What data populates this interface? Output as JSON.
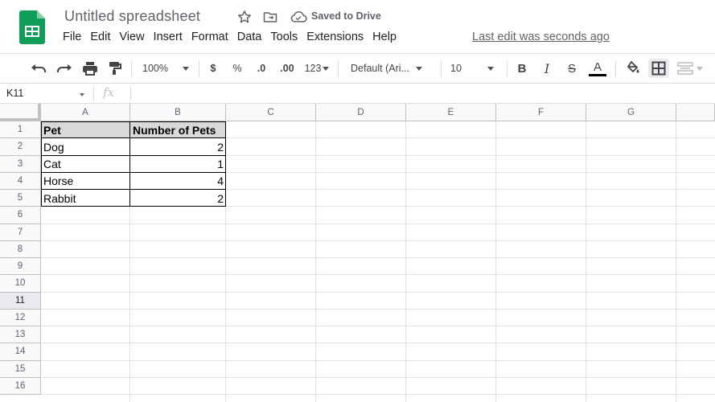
{
  "app": {
    "doc_title": "Untitled spreadsheet",
    "saved_status": "Saved to Drive",
    "last_edit": "Last edit was seconds ago",
    "brand_color": "#0f9d58"
  },
  "menu": [
    "File",
    "Edit",
    "View",
    "Insert",
    "Format",
    "Data",
    "Tools",
    "Extensions",
    "Help"
  ],
  "toolbar": {
    "zoom": "100%",
    "currency": "$",
    "percent": "%",
    "decrease_decimal": ".0",
    "increase_decimal": ".00",
    "more_formats": "123",
    "font": "Default (Ari...",
    "font_size": "10",
    "bold": "B",
    "italic": "I",
    "strike": "S",
    "text_color": "A"
  },
  "formula_bar": {
    "cell_ref": "K11",
    "fx": "fx",
    "value": ""
  },
  "sheet": {
    "columns": [
      "A",
      "B",
      "C",
      "D",
      "E",
      "F",
      "G"
    ],
    "rows": [
      "1",
      "2",
      "3",
      "4",
      "5",
      "6",
      "7",
      "8",
      "9",
      "10",
      "11",
      "12",
      "13",
      "14",
      "15",
      "16"
    ],
    "selected_row": "11",
    "header_fill": "#d9d9d9",
    "cells": {
      "A1": "Pet",
      "B1": "Number of Pets",
      "A2": "Dog",
      "B2": "2",
      "A3": "Cat",
      "B3": "1",
      "A4": "Horse",
      "B4": "4",
      "A5": "Rabbit",
      "B5": "2"
    }
  }
}
